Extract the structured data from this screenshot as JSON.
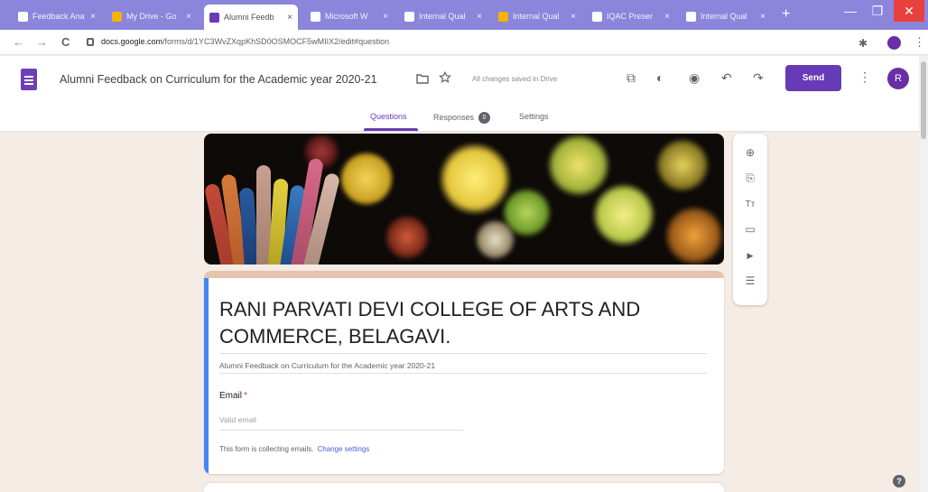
{
  "browser": {
    "tabs": [
      {
        "label": "Feedback Ana",
        "fav": "#ffffff",
        "close": "×",
        "active": false
      },
      {
        "label": "My Drive - Go",
        "fav": "#f4b400",
        "close": "×",
        "active": false
      },
      {
        "label": "Alumni Feedb",
        "fav": "#673ab7",
        "close": "×",
        "active": true
      },
      {
        "label": "Microsoft W",
        "fav": "#ffffff",
        "close": "×",
        "active": false
      },
      {
        "label": "Internal Qual",
        "fav": "#ffffff",
        "close": "×",
        "active": false
      },
      {
        "label": "Internal Qual",
        "fav": "#f4b400",
        "close": "×",
        "active": false
      },
      {
        "label": "IQAC Preser",
        "fav": "#ffffff",
        "close": "×",
        "active": false
      },
      {
        "label": "Internal Qual",
        "fav": "#ffffff",
        "close": "×",
        "active": false
      }
    ],
    "new_tab": "+",
    "window_controls": {
      "minimize": "—",
      "maximize": "❐",
      "close": "✕"
    },
    "nav": {
      "back": "←",
      "forward": "→",
      "reload": "C"
    },
    "url_domain": "docs.google.com",
    "url_path": "/forms/d/1YC3WvZXqpKhSD0OSMOCF5wMIIX2/edit#question",
    "address_icons": {
      "extension": "✱",
      "menu": "⋮"
    }
  },
  "header": {
    "title": "Alumni Feedback on Curriculum for the Academic year 2020-21",
    "folder_icon": "folder-icon",
    "star_icon": "star-icon",
    "saved_status": "All changes saved in Drive",
    "actions": {
      "addon": "⧉",
      "palette": "◐",
      "preview": "◉",
      "undo": "↶",
      "redo": "↷"
    },
    "send_label": "Send",
    "more_label": "⋮",
    "avatar_initial": "R"
  },
  "form_tabs": {
    "questions": "Questions",
    "responses": "Responses",
    "responses_count": "0",
    "settings": "Settings"
  },
  "form": {
    "title": "RANI PARVATI DEVI COLLEGE OF ARTS AND COMMERCE, BELAGAVI.",
    "description": "Alumni Feedback on Curriculum for the Academic year 2020-21",
    "email_label": "Email",
    "required_mark": "*",
    "email_placeholder": "Valid email",
    "collect_note": "This form is collecting emails.",
    "change_settings": "Change settings"
  },
  "toolbar": {
    "add_question": "⊕",
    "import_questions": "⎘",
    "add_title": "Tт",
    "add_image": "▭",
    "add_video": "▶",
    "add_section": "☰"
  },
  "help": "?",
  "colors": {
    "accent": "#673ab7",
    "tab_strip": "#8b85dc",
    "page_bg": "#f6ece6",
    "card_top": "#e6c3ac",
    "focus_bar": "#4285f4"
  }
}
